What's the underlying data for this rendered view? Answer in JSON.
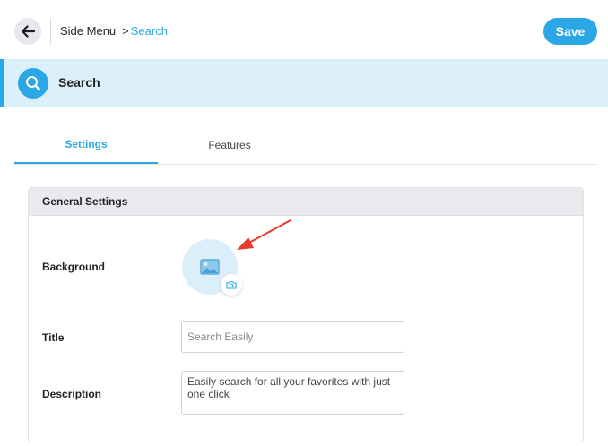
{
  "header": {
    "breadcrumb_root": "Side Menu",
    "breadcrumb_separator": ">",
    "breadcrumb_current": "Search",
    "save_label": "Save"
  },
  "banner": {
    "title": "Search",
    "icon": "search-icon"
  },
  "tabs": [
    {
      "label": "Settings",
      "active": true
    },
    {
      "label": "Features",
      "active": false
    }
  ],
  "general_settings": {
    "heading": "General Settings",
    "background_label": "Background",
    "background_icon": "image-placeholder-icon",
    "upload_icon": "camera-icon",
    "title_label": "Title",
    "title_placeholder": "Search Easily",
    "description_label": "Description",
    "description_value": "Easily search for all your favorites with just one click"
  },
  "colors": {
    "accent": "#2aa7e4",
    "banner_bg": "#dcf0fb",
    "annotation": "#e8392b"
  }
}
